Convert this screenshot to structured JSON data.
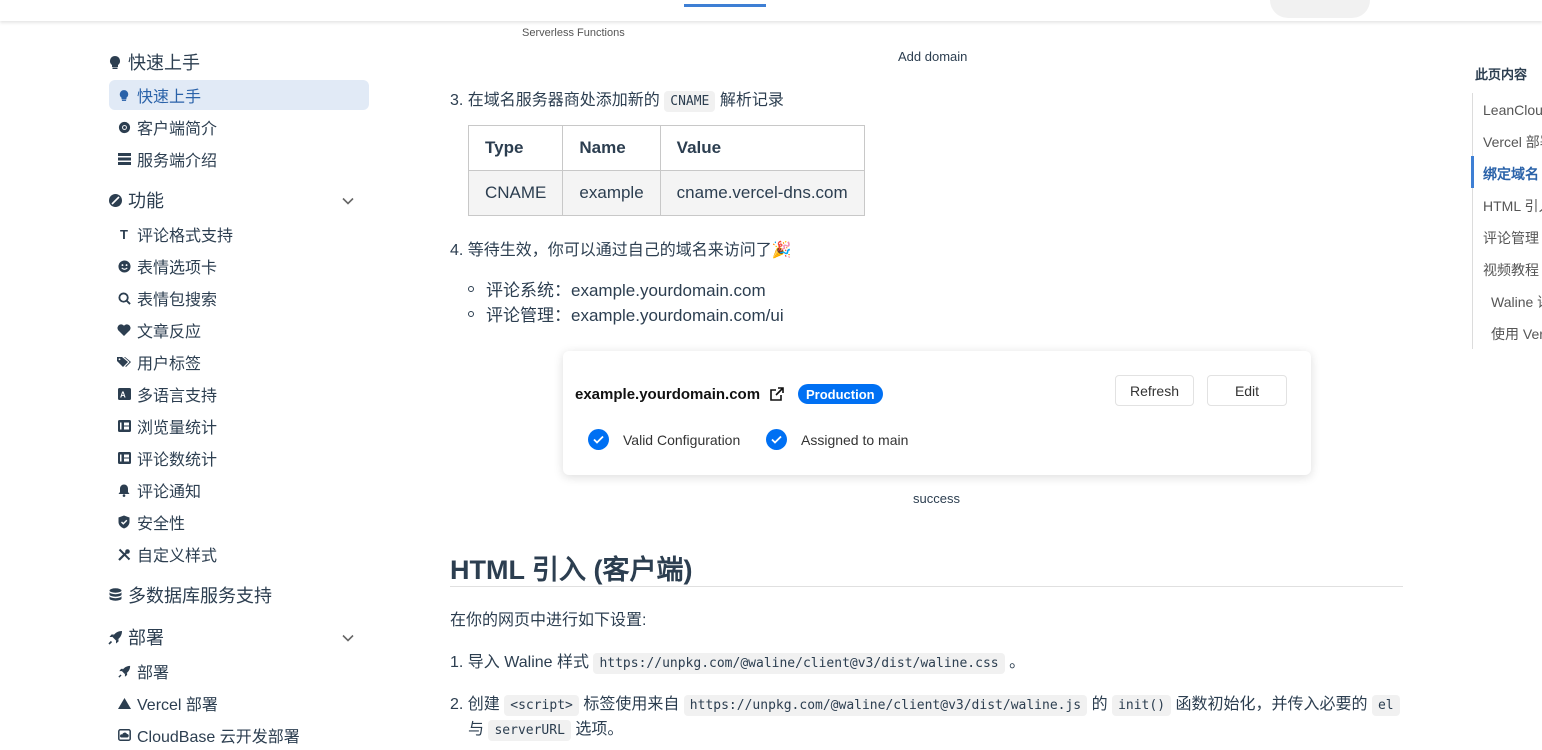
{
  "top_captions": {
    "serverless": "Serverless Functions",
    "add_domain": "Add domain"
  },
  "sidebar": {
    "groups": [
      {
        "label": "快速上手",
        "items": [
          {
            "label": "快速上手",
            "icon": "lightbulb-icon",
            "active": true
          },
          {
            "label": "客户端简介",
            "icon": "chrome-icon"
          },
          {
            "label": "服务端介绍",
            "icon": "server-icon"
          }
        ]
      },
      {
        "label": "功能",
        "items": [
          {
            "label": "评论格式支持",
            "icon": "text-format-icon"
          },
          {
            "label": "表情选项卡",
            "icon": "smile-icon"
          },
          {
            "label": "表情包搜索",
            "icon": "search-icon"
          },
          {
            "label": "文章反应",
            "icon": "heart-icon"
          },
          {
            "label": "用户标签",
            "icon": "tag-icon"
          },
          {
            "label": "多语言支持",
            "icon": "language-icon"
          },
          {
            "label": "浏览量统计",
            "icon": "counter-icon"
          },
          {
            "label": "评论数统计",
            "icon": "counter-icon"
          },
          {
            "label": "评论通知",
            "icon": "bell-icon"
          },
          {
            "label": "安全性",
            "icon": "shield-icon"
          },
          {
            "label": "自定义样式",
            "icon": "tools-icon"
          }
        ]
      },
      {
        "label": "多数据库服务支持"
      },
      {
        "label": "部署",
        "items": [
          {
            "label": "部署",
            "icon": "rocket-icon"
          },
          {
            "label": "Vercel 部署",
            "icon": "vercel-icon"
          },
          {
            "label": "CloudBase 云开发部署",
            "icon": "cloud-icon"
          }
        ]
      }
    ]
  },
  "main": {
    "step3": {
      "prefix": "3. 在域名服务器商处添加新的",
      "code": "CNAME",
      "suffix": "解析记录"
    },
    "table": {
      "headers": [
        "Type",
        "Name",
        "Value"
      ],
      "rows": [
        [
          "CNAME",
          "example",
          "cname.vercel-dns.com"
        ]
      ]
    },
    "step4": "4. 等待生效，你可以通过自己的域名来访问了🎉",
    "bullets": [
      "评论系统：example.yourdomain.com",
      "评论管理：example.yourdomain.com/ui"
    ],
    "card": {
      "domain": "example.yourdomain.com",
      "badge": "Production",
      "refresh": "Refresh",
      "edit": "Edit",
      "check1": "Valid Configuration",
      "check2": "Assigned to main",
      "accent": "#0070f3"
    },
    "caption_success": "success",
    "h2": "HTML 引入 (客户端)",
    "intro": "在你的网页中进行如下设置:",
    "s1": {
      "prefix": "1. 导入 Waline 样式",
      "code": "https://unpkg.com/@waline/client@v3/dist/waline.css",
      "suffix": "。"
    },
    "s2": {
      "a": "2. 创建",
      "code1": "<script>",
      "b": "标签使用来自",
      "code2": "https://unpkg.com/@waline/client@v3/dist/waline.js",
      "c": "的",
      "code3": "init()",
      "d": "函数初始化，并传入必要的",
      "code4": "el",
      "e": "与",
      "code5": "serverURL",
      "f": "选项。"
    }
  },
  "toc": {
    "title": "此页内容",
    "items": [
      {
        "label": "LeanCloud 设置 (数据库)"
      },
      {
        "label": "Vercel 部署 (服务端)"
      },
      {
        "label": "绑定域名 (可选)",
        "active": true
      },
      {
        "label": "HTML 引入 (客户端)"
      },
      {
        "label": "评论管理 (管理端)"
      },
      {
        "label": "视频教程"
      },
      {
        "label": "Waline 评论系统",
        "sub": true
      },
      {
        "label": "使用 Vercel 部署",
        "sub": true
      }
    ]
  }
}
